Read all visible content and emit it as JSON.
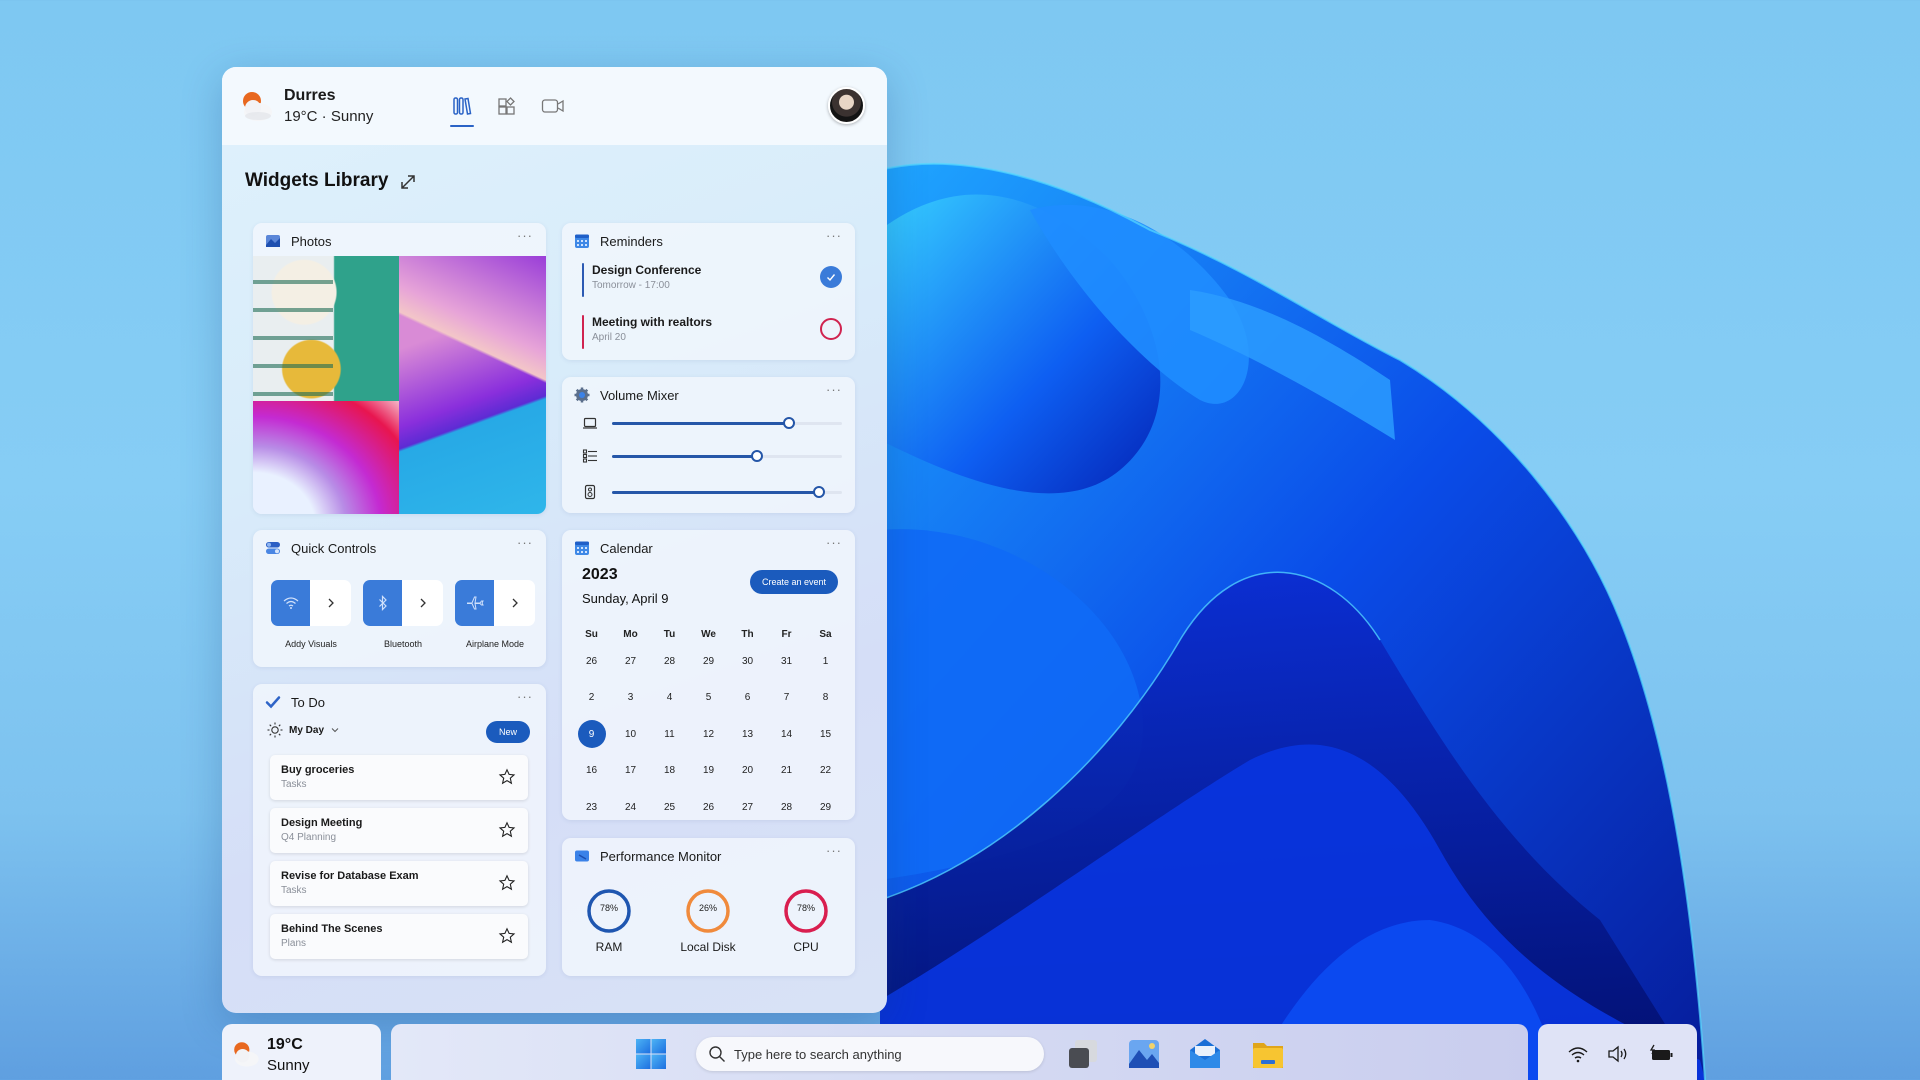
{
  "header": {
    "city": "Durres",
    "condition": "19°C · Sunny",
    "tabs": [
      {
        "name": "widgets-library-tab",
        "icon": "library-icon",
        "active": true
      },
      {
        "name": "widgets-add-tab",
        "icon": "widgets-icon",
        "active": false
      },
      {
        "name": "video-tab",
        "icon": "video-camera-icon",
        "active": false
      }
    ],
    "avatar": "user-avatar"
  },
  "library": {
    "title": "Widgets Library",
    "expand_icon": "expand-icon"
  },
  "widgets": {
    "photos": {
      "title": "Photos",
      "icon": "photos-icon",
      "more": "···"
    },
    "reminders": {
      "title": "Reminders",
      "icon": "calendar-grid-icon",
      "more": "···",
      "items": [
        {
          "title": "Design Conference",
          "subtitle": "Tomorrow - 17:00",
          "completed": true,
          "accent": "#2c5ab3"
        },
        {
          "title": "Meeting with realtors",
          "subtitle": "April 20",
          "completed": false,
          "accent": "#d0234f"
        }
      ]
    },
    "volume": {
      "title": "Volume Mixer",
      "icon": "gear-icon",
      "more": "···",
      "channels": [
        {
          "icon": "laptop-icon",
          "level": 0.77
        },
        {
          "icon": "list-icon",
          "level": 0.63
        },
        {
          "icon": "speaker-icon",
          "level": 0.9
        }
      ]
    },
    "quick_controls": {
      "title": "Quick Controls",
      "icon": "toggles-icon",
      "more": "···",
      "items": [
        {
          "label": "Addy Visuals",
          "icon": "wifi-icon"
        },
        {
          "label": "Bluetooth",
          "icon": "bluetooth-icon"
        },
        {
          "label": "Airplane Mode",
          "icon": "airplane-icon"
        }
      ]
    },
    "calendar": {
      "title": "Calendar",
      "icon": "calendar-grid-icon",
      "more": "···",
      "year": "2023",
      "date": "Sunday, April 9",
      "create_label": "Create an event",
      "weekdays": [
        "Su",
        "Mo",
        "Tu",
        "We",
        "Th",
        "Fr",
        "Sa"
      ],
      "weeks": [
        [
          "26",
          "27",
          "28",
          "29",
          "30",
          "31",
          "1"
        ],
        [
          "2",
          "3",
          "4",
          "5",
          "6",
          "7",
          "8"
        ],
        [
          "9",
          "10",
          "11",
          "12",
          "13",
          "14",
          "15"
        ],
        [
          "16",
          "17",
          "18",
          "19",
          "20",
          "21",
          "22"
        ],
        [
          "23",
          "24",
          "25",
          "26",
          "27",
          "28",
          "29"
        ]
      ],
      "selected": "9"
    },
    "todo": {
      "title": "To Do",
      "icon": "checkmark-icon",
      "more": "···",
      "list_name": "My Day",
      "new_label": "New",
      "items": [
        {
          "title": "Buy groceries",
          "subtitle": "Tasks"
        },
        {
          "title": "Design Meeting",
          "subtitle": "Q4 Planning"
        },
        {
          "title": "Revise for Database Exam",
          "subtitle": "Tasks"
        },
        {
          "title": "Behind The Scenes",
          "subtitle": "Plans"
        }
      ]
    },
    "performance": {
      "title": "Performance Monitor",
      "icon": "monitor-icon",
      "more": "···",
      "gauges": [
        {
          "label": "RAM",
          "value": "78%",
          "color": "#1f56b0"
        },
        {
          "label": "Local Disk",
          "value": "26%",
          "color": "#f08a3c"
        },
        {
          "label": "CPU",
          "value": "78%",
          "color": "#d91e4f"
        }
      ]
    }
  },
  "taskbar": {
    "weather": {
      "temp": "19°C",
      "condition": "Sunny"
    },
    "search_placeholder": "Type here to search anything",
    "apps": [
      {
        "name": "task-view",
        "icon": "task-view-icon"
      },
      {
        "name": "photos",
        "icon": "photos-app-icon"
      },
      {
        "name": "mail",
        "icon": "mail-icon"
      },
      {
        "name": "file-explorer",
        "icon": "folder-icon"
      }
    ],
    "tray": [
      {
        "name": "wifi",
        "icon": "wifi-icon"
      },
      {
        "name": "volume",
        "icon": "volume-icon"
      },
      {
        "name": "battery",
        "icon": "battery-charging-icon"
      }
    ]
  },
  "colors": {
    "accent": "#1b5bbd",
    "toggle_on": "#3a7bd9"
  }
}
